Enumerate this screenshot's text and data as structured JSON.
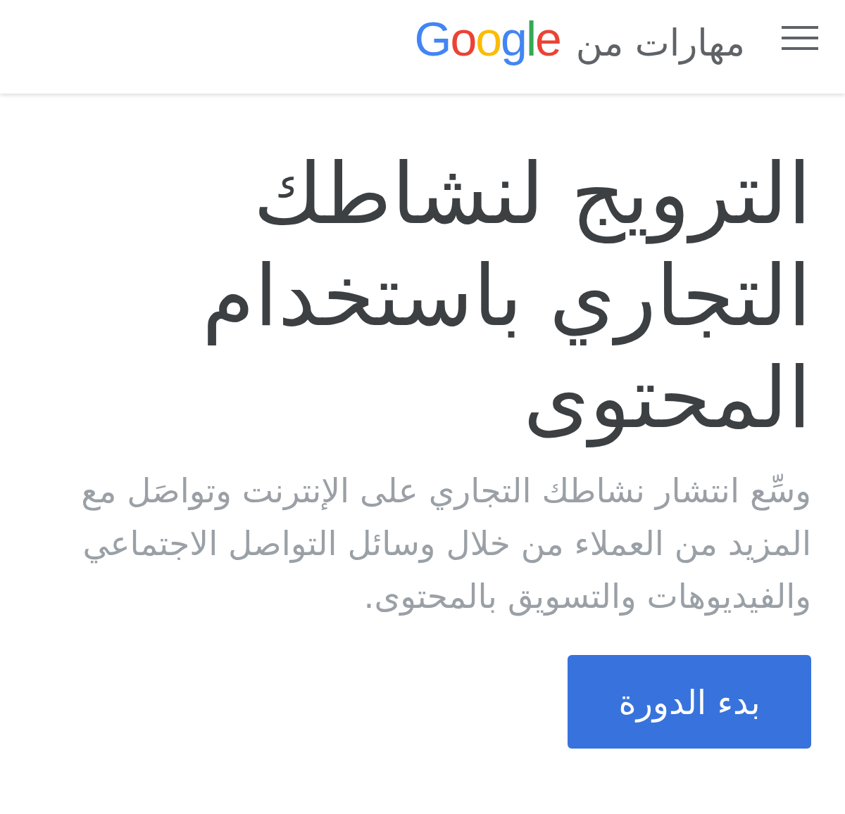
{
  "header": {
    "brand_text": "مهارات من",
    "logo_text": "Google"
  },
  "hero": {
    "title": "الترويج لنشاطك التجاري باستخدام المحتوى",
    "description": "وسِّع انتشار نشاطك التجاري على الإنترنت وتواصَل مع المزيد من العملاء من خلال وسائل التواصل الاجتماعي والفيديوهات والتسويق بالمحتوى.",
    "button": "بدء الدورة"
  }
}
